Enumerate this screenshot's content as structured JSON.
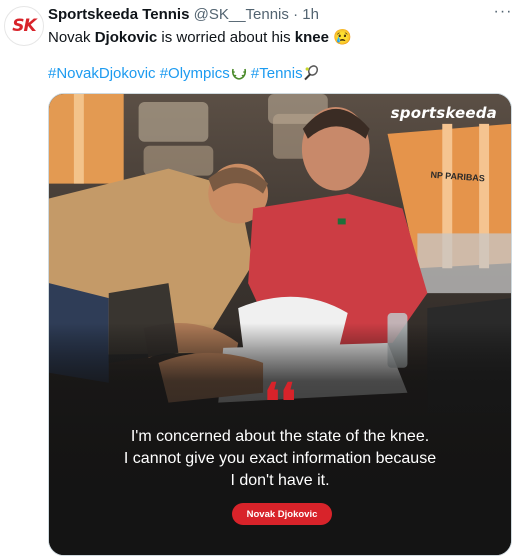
{
  "tweet": {
    "author_name": "Sportskeeda Tennis",
    "handle": "@SK__Tennis",
    "separator": "·",
    "time": "1h",
    "more_label": "···",
    "text_part1": "Novak ",
    "text_bold1": "Djokovic",
    "text_part2": " is worried about his ",
    "text_bold2": "knee",
    "text_emoji": "😢",
    "hashtags": [
      "#NovakDjokovic",
      "#Olympics",
      "#Tennis"
    ],
    "hashtag_space": " "
  },
  "avatar": {
    "logo_text": "SK"
  },
  "media": {
    "brand": "sportskeeda",
    "quote_mark": "❛❛",
    "quote_lines": [
      "I'm concerned about the state of the knee.",
      "I cannot give you exact information because",
      "I don't have it."
    ],
    "speaker": "Novak Djokovic",
    "shirt_text": "NP PARIBAS"
  },
  "colors": {
    "link": "#1d9bf0",
    "accent_red": "#d8232a",
    "text_primary": "#0f1419",
    "text_secondary": "#536471"
  },
  "icons": [
    "more-icon",
    "laurel-icon",
    "tennis-racket-icon",
    "crying-face-icon"
  ]
}
